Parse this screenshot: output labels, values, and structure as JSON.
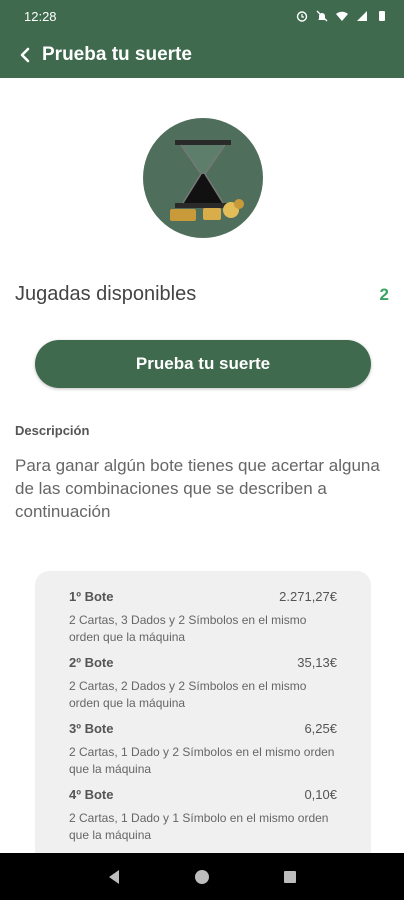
{
  "status_bar": {
    "time": "12:28"
  },
  "header": {
    "title": "Prueba tu suerte"
  },
  "available": {
    "label": "Jugadas disponibles",
    "count": "2"
  },
  "cta": {
    "label": "Prueba tu suerte"
  },
  "description": {
    "heading": "Descripción",
    "text": "Para ganar algún bote tienes que acertar alguna de las combinaciones que se describen a continuación"
  },
  "prizes": [
    {
      "name": "1º Bote",
      "amount": "2.271,27€",
      "desc": "2 Cartas, 3 Dados y 2 Símbolos en el mismo orden que la máquina"
    },
    {
      "name": "2º Bote",
      "amount": "35,13€",
      "desc": "2 Cartas, 2 Dados y 2 Símbolos en el mismo orden que la máquina"
    },
    {
      "name": "3º Bote",
      "amount": "6,25€",
      "desc": "2 Cartas, 1 Dado y 2 Símbolos en el mismo orden que la máquina"
    },
    {
      "name": "4º Bote",
      "amount": "0,10€",
      "desc": "2 Cartas, 1 Dado y 1 Símbolo en el mismo orden que la máquina"
    }
  ],
  "colors": {
    "primary": "#3f6a4e",
    "accent": "#3aa464",
    "card_bg": "#f0f0f0"
  }
}
